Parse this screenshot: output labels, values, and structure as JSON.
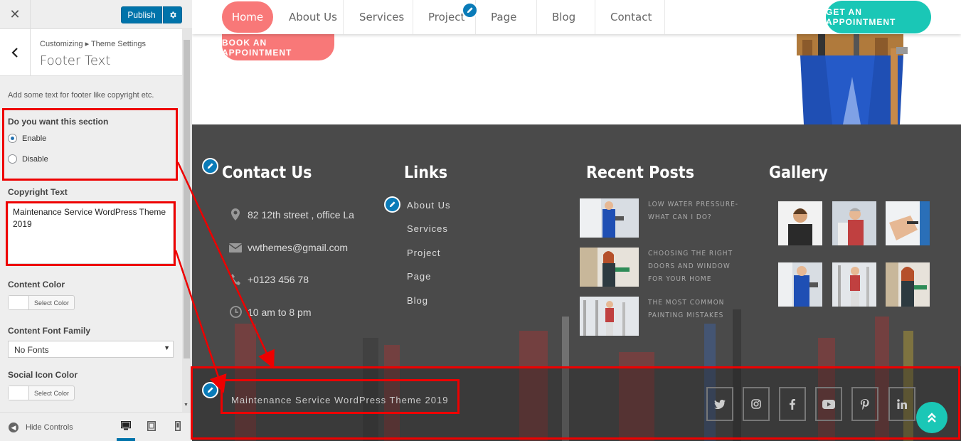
{
  "customizer": {
    "publish_label": "Publish",
    "breadcrumb": "Customizing ▸ Theme Settings",
    "section_title": "Footer Text",
    "description": "Add some text for footer like copyright etc.",
    "section_toggle_label": "Do you want this section",
    "enable_label": "Enable",
    "disable_label": "Disable",
    "copyright_label": "Copyright Text",
    "copyright_value": "Maintenance Service WordPress Theme 2019",
    "content_color_label": "Content Color",
    "select_color_label": "Select Color",
    "font_family_label": "Content Font Family",
    "font_family_value": "No Fonts",
    "social_color_label": "Social Icon Color",
    "hide_controls_label": "Hide Controls",
    "accent_color": "#0073aa"
  },
  "nav": {
    "home": "Home",
    "items": [
      "About Us",
      "Services",
      "Project",
      "Page",
      "Blog",
      "Contact"
    ],
    "appointment": "GET AN APPOINTMENT",
    "hero_button": "BOOK AN APPOINTMENT",
    "accent_color": "#f87878",
    "teal_color": "#1ac7b6"
  },
  "footer": {
    "contact_title": "Contact Us",
    "address": "82 12th street , office La",
    "email": "vwthemes@gmail.com",
    "phone": "+0123 456 78",
    "hours": "10 am to 8 pm",
    "links_title": "Links",
    "links": [
      "About Us",
      "Services",
      "Project",
      "Page",
      "Blog"
    ],
    "posts_title": "Recent Posts",
    "posts": [
      "LOW WATER PRESSURE-WHAT CAN I DO?",
      "CHOOSING THE RIGHT DOORS AND WINDOW FOR YOUR HOME",
      "THE MOST COMMON PAINTING MISTAKES"
    ],
    "gallery_title": "Gallery",
    "copyright": "Maintenance Service WordPress Theme 2019",
    "social_icons": [
      "twitter-icon",
      "instagram-icon",
      "facebook-icon",
      "youtube-icon",
      "pinterest-icon",
      "linkedin-icon"
    ]
  }
}
